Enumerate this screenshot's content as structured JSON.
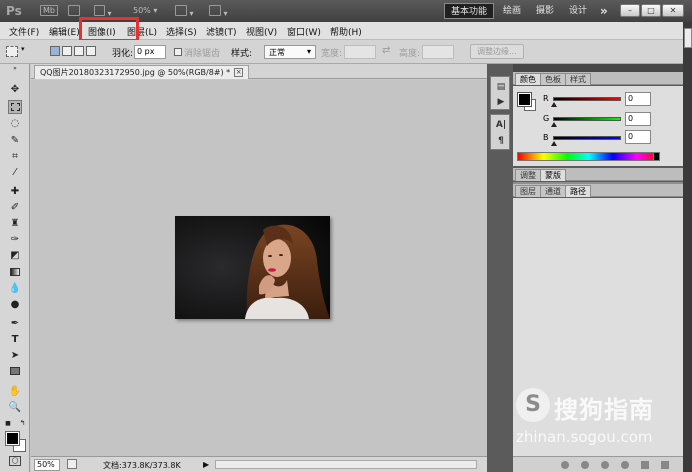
{
  "titlebar": {
    "logo": "Ps",
    "mb": "Mb",
    "zoom": "50%",
    "workspaces": [
      "基本功能",
      "绘画",
      "摄影",
      "设计"
    ],
    "more": "»",
    "minimize": "–",
    "restore": "□",
    "close": "✕"
  },
  "menu": {
    "items": [
      "文件(F)",
      "编辑(E)",
      "图像(I)",
      "图层(L)",
      "选择(S)",
      "滤镜(T)",
      "视图(V)",
      "窗口(W)",
      "帮助(H)"
    ]
  },
  "options": {
    "feather_label": "羽化:",
    "feather_value": "0 px",
    "antialias_label": "消除锯齿",
    "style_label": "样式:",
    "style_value": "正常",
    "width_label": "宽度:",
    "height_label": "高度:",
    "refine_edge": "调整边缘..."
  },
  "document": {
    "tab_title": "QQ图片20180323172950.jpg @ 50%(RGB/8#) *",
    "close": "×"
  },
  "status": {
    "zoom": "50%",
    "doc_info": "文档:373.8K/373.8K"
  },
  "panels": {
    "color_tabs": [
      "颜色",
      "色板",
      "样式"
    ],
    "r_label": "R",
    "g_label": "G",
    "b_label": "B",
    "r_value": "0",
    "g_value": "0",
    "b_value": "0",
    "adjust_tabs": [
      "调整",
      "蒙版"
    ],
    "layer_tabs": [
      "图层",
      "通道",
      "路径"
    ]
  },
  "watermark": {
    "text": "搜狗指南",
    "url": "zhinan.sogou.com"
  }
}
